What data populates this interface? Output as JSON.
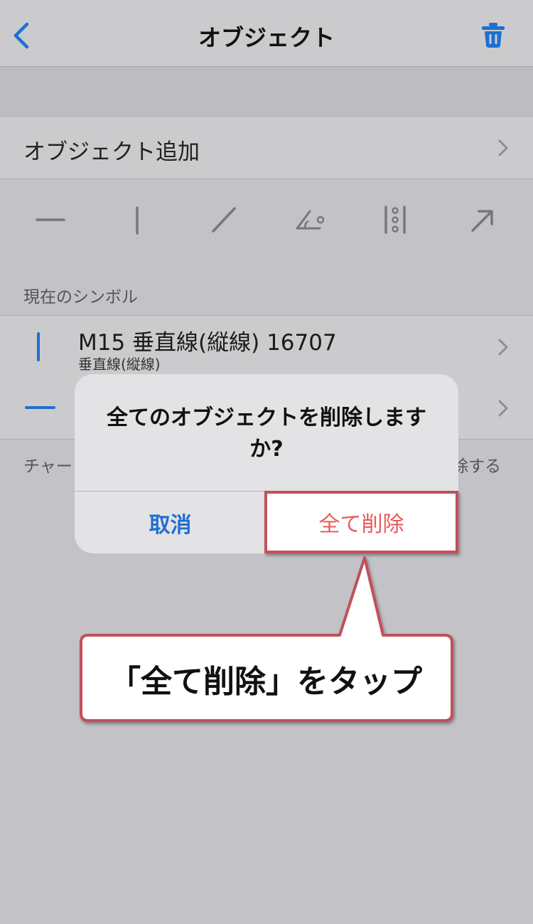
{
  "nav": {
    "title": "オブジェクト",
    "back_icon": "chevron-left-icon",
    "trash_icon": "trash-icon"
  },
  "add_object": {
    "label": "オブジェクト追加"
  },
  "tools": [
    "horizontal-line-icon",
    "vertical-line-icon",
    "trend-line-icon",
    "angle-icon",
    "fibonacci-icon",
    "arrow-icon"
  ],
  "section": {
    "header": "現在のシンボル"
  },
  "symbols": [
    {
      "title": "M15 垂直線(縦線) 16707",
      "subtitle": "垂直線(縦線)",
      "icon": "vertical-line-icon"
    },
    {
      "icon": "horizontal-line-icon"
    }
  ],
  "footer": {
    "left_fragment": "チャー",
    "right_fragment": "除する"
  },
  "alert": {
    "message": "全てのオブジェクトを削除しますか?",
    "cancel_label": "取消",
    "delete_label": "全て削除"
  },
  "callout": {
    "text": "「全て削除」をタップ"
  },
  "colors": {
    "accent": "#1f6fd0",
    "destructive": "#ea5a5a",
    "highlight_border": "#c2505b"
  }
}
